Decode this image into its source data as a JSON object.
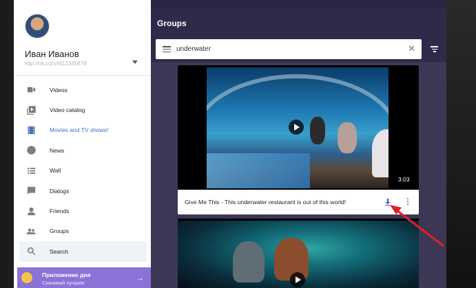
{
  "user": {
    "name": "Иван Иванов",
    "profile_url": "http://vk.com/id12345678"
  },
  "menu": {
    "items": [
      {
        "label": "Videos",
        "icon": "video-camera-icon"
      },
      {
        "label": "Video catalog",
        "icon": "video-library-icon"
      },
      {
        "label": "Movies and TV shows!",
        "icon": "film-icon"
      },
      {
        "label": "News",
        "icon": "globe-icon"
      },
      {
        "label": "Wall",
        "icon": "list-icon"
      },
      {
        "label": "Dialogs",
        "icon": "chat-icon"
      },
      {
        "label": "Friends",
        "icon": "person-icon"
      },
      {
        "label": "Groups",
        "icon": "group-icon"
      },
      {
        "label": "Search",
        "icon": "search-icon"
      }
    ],
    "active_item": "Movies and TV shows!",
    "selected_item": "Search"
  },
  "promo": {
    "title": "Приложение дня",
    "subtitle": "Скачивай лучшее",
    "arrow": "→"
  },
  "header": {
    "title": "Groups"
  },
  "search": {
    "value": "underwater",
    "clear": "✕"
  },
  "results": [
    {
      "title": "Give Me This - This underwater restaurant is out of this world!",
      "duration": "3:03"
    }
  ],
  "colors": {
    "accent": "#4a6fb8",
    "promo": "#8a72d8",
    "header": "#302a4a",
    "main_bg": "#3d3756",
    "download": "#5b57d0",
    "annotation": "#e0202a"
  }
}
